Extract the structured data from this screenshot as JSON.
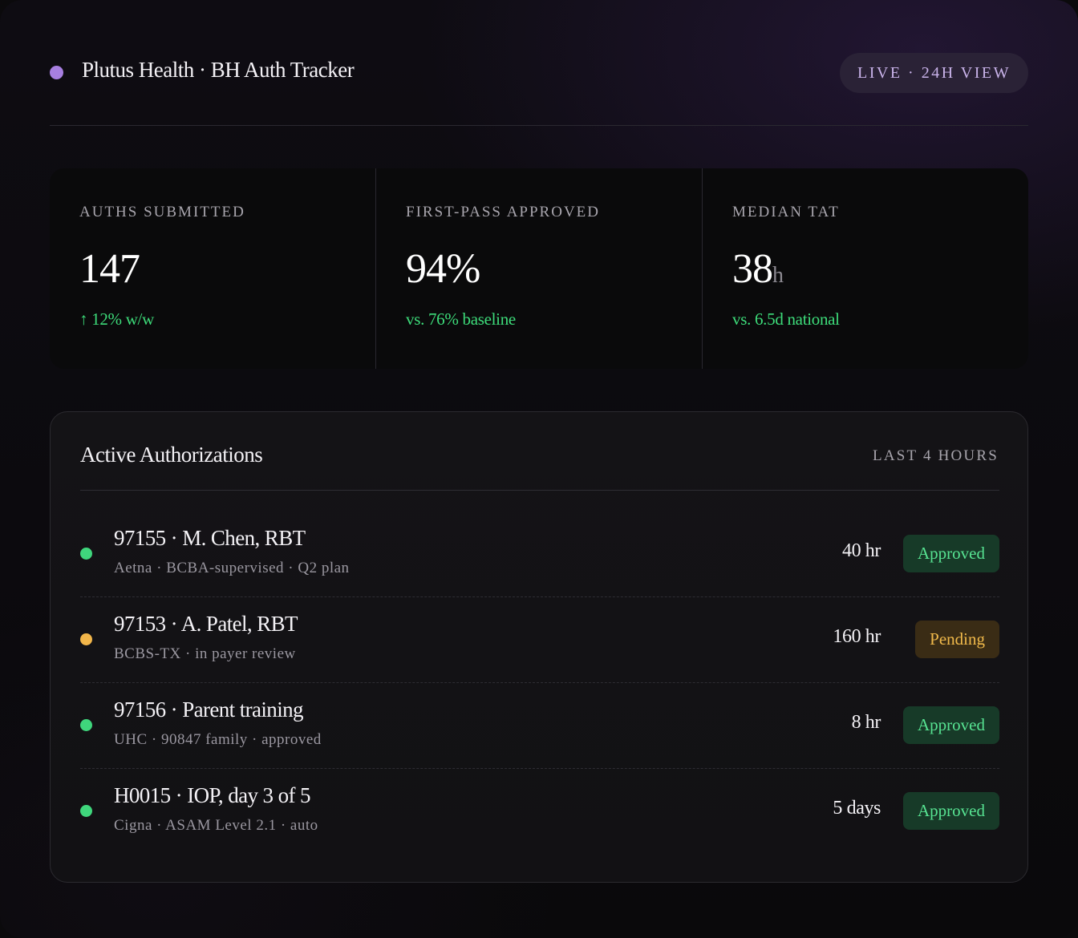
{
  "header": {
    "title": "Plutus Health · BH Auth Tracker",
    "live_label": "LIVE · 24H VIEW"
  },
  "colors": {
    "brand_dot": "#a77fe0",
    "positive": "#3ddc7a",
    "approved_dot": "#3fd67c",
    "pending_dot": "#f2b64a"
  },
  "stats": [
    {
      "label": "AUTHS SUBMITTED",
      "value": "147",
      "unit": "",
      "sub": "↑ 12% w/w"
    },
    {
      "label": "FIRST-PASS APPROVED",
      "value": "94%",
      "unit": "",
      "sub": "vs. 76% baseline"
    },
    {
      "label": "MEDIAN TAT",
      "value": "38",
      "unit": "h",
      "sub": "vs. 6.5d national"
    }
  ],
  "authorizations": {
    "title": "Active Authorizations",
    "meta": "LAST 4 HOURS",
    "rows": [
      {
        "title": "97155 · M. Chen, RBT",
        "sub": "Aetna · BCBA-supervised · Q2 plan",
        "qty": "40 hr",
        "status": "Approved",
        "status_kind": "approved"
      },
      {
        "title": "97153 · A. Patel, RBT",
        "sub": "BCBS-TX · in payer review",
        "qty": "160 hr",
        "status": "Pending",
        "status_kind": "pending"
      },
      {
        "title": "97156 · Parent training",
        "sub": "UHC · 90847 family · approved",
        "qty": "8 hr",
        "status": "Approved",
        "status_kind": "approved"
      },
      {
        "title": "H0015 · IOP, day 3 of 5",
        "sub": "Cigna · ASAM Level 2.1 · auto",
        "qty": "5 days",
        "status": "Approved",
        "status_kind": "approved"
      }
    ]
  }
}
